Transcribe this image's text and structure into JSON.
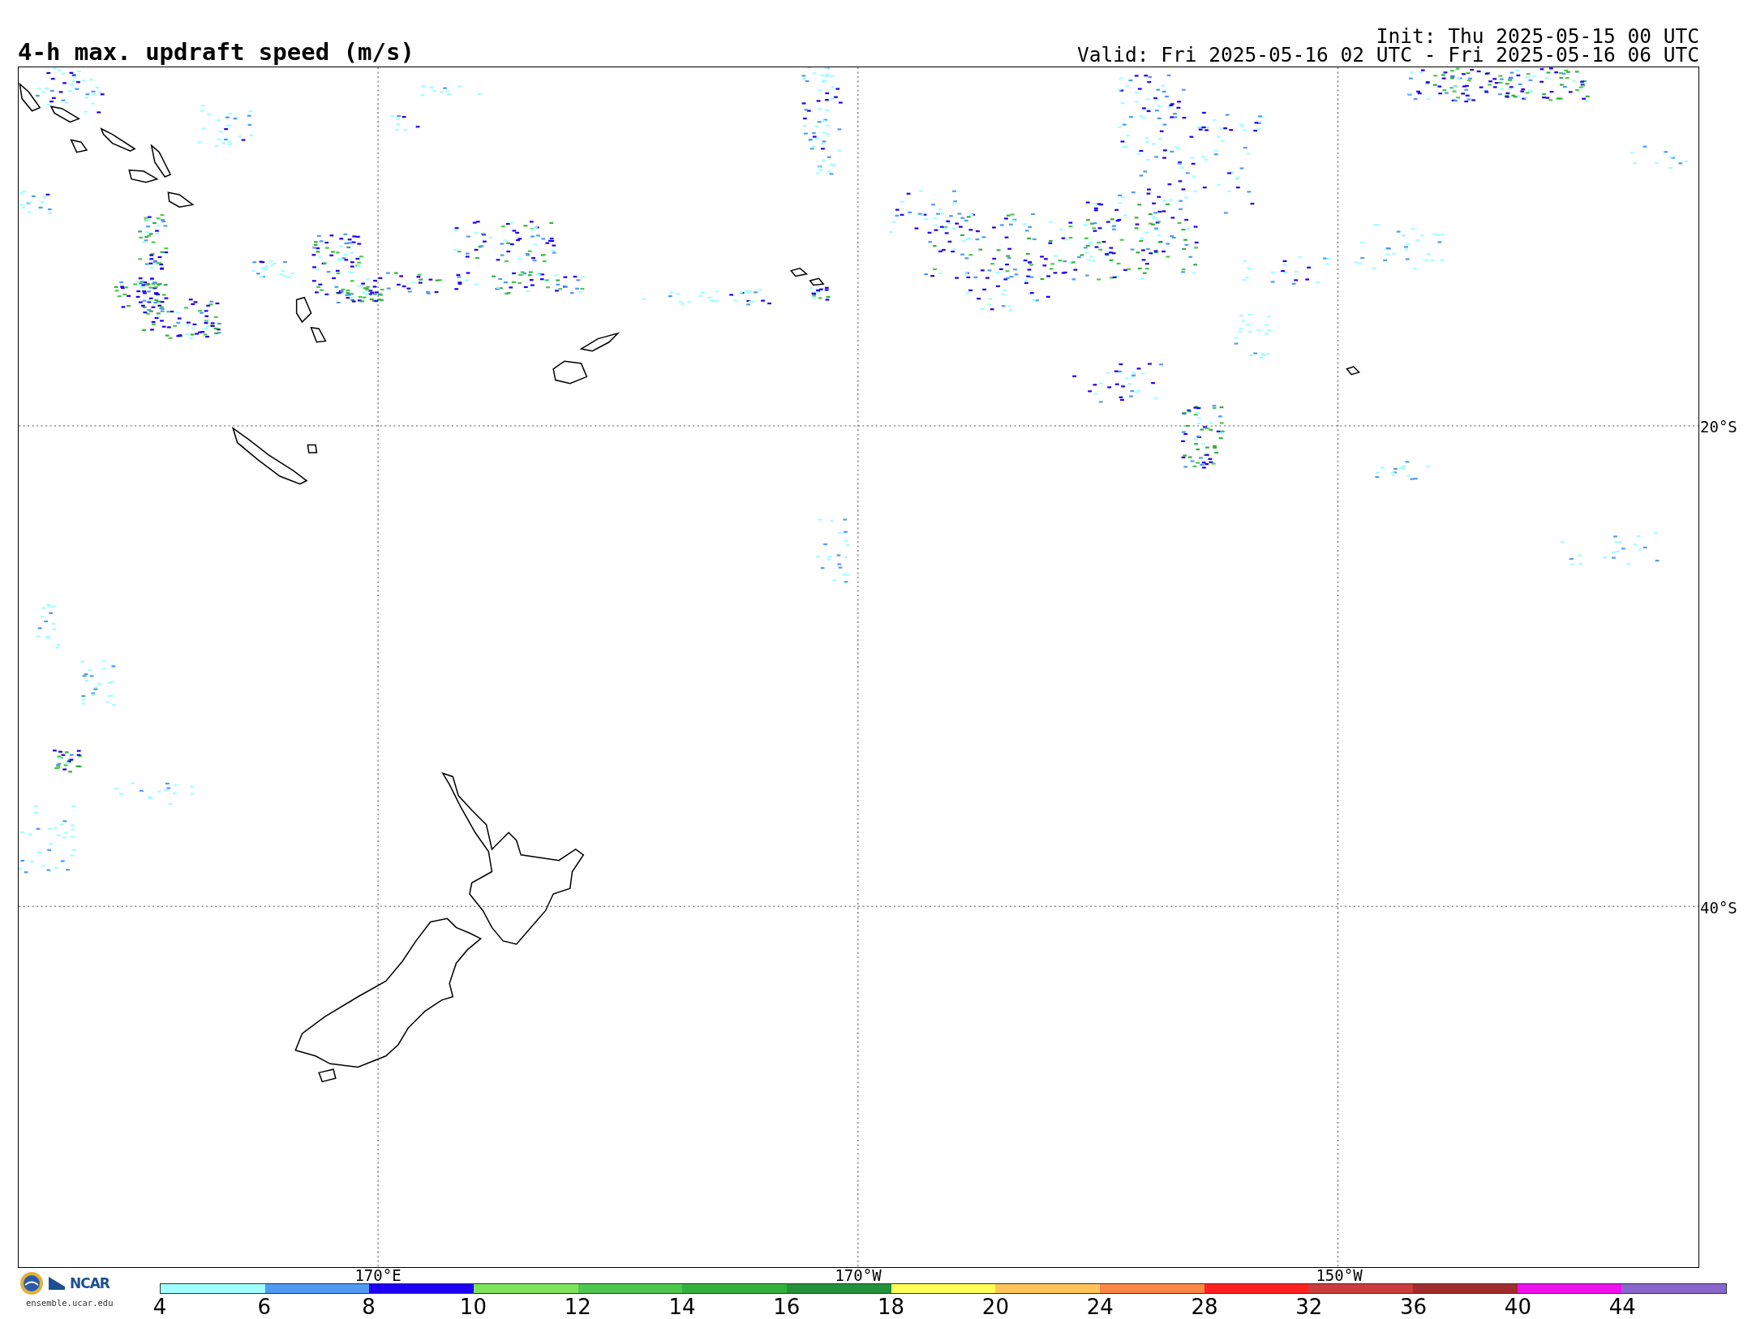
{
  "title": "4-h max. updraft speed (m/s)",
  "init": "Init: Thu 2025-05-15 00 UTC",
  "valid": "Valid: Fri 2025-05-16 02 UTC - Fri 2025-05-16 06 UTC",
  "map": {
    "latitude_labels": [
      "20°S",
      "40°S"
    ],
    "longitude_labels": [
      "170°E",
      "170°W",
      "150°W"
    ]
  },
  "colorbar": [
    {
      "label": "4",
      "color": "#a0ffff"
    },
    {
      "label": "6",
      "color": "#4f9bf5"
    },
    {
      "label": "8",
      "color": "#1e00f5"
    },
    {
      "label": "10",
      "color": "#7de35a"
    },
    {
      "label": "12",
      "color": "#4dc74d"
    },
    {
      "label": "14",
      "color": "#33b03c"
    },
    {
      "label": "16",
      "color": "#22913a"
    },
    {
      "label": "18",
      "color": "#ffff55"
    },
    {
      "label": "20",
      "color": "#ffc55a"
    },
    {
      "label": "24",
      "color": "#ff8745"
    },
    {
      "label": "28",
      "color": "#ff2020"
    },
    {
      "label": "32",
      "color": "#cc3c3c"
    },
    {
      "label": "36",
      "color": "#a02c2c"
    },
    {
      "label": "40",
      "color": "#ee10ee"
    },
    {
      "label": "44",
      "color": "#8866cc"
    }
  ],
  "logo": {
    "name": "NCAR",
    "url": "ensemble.ucar.edu"
  }
}
